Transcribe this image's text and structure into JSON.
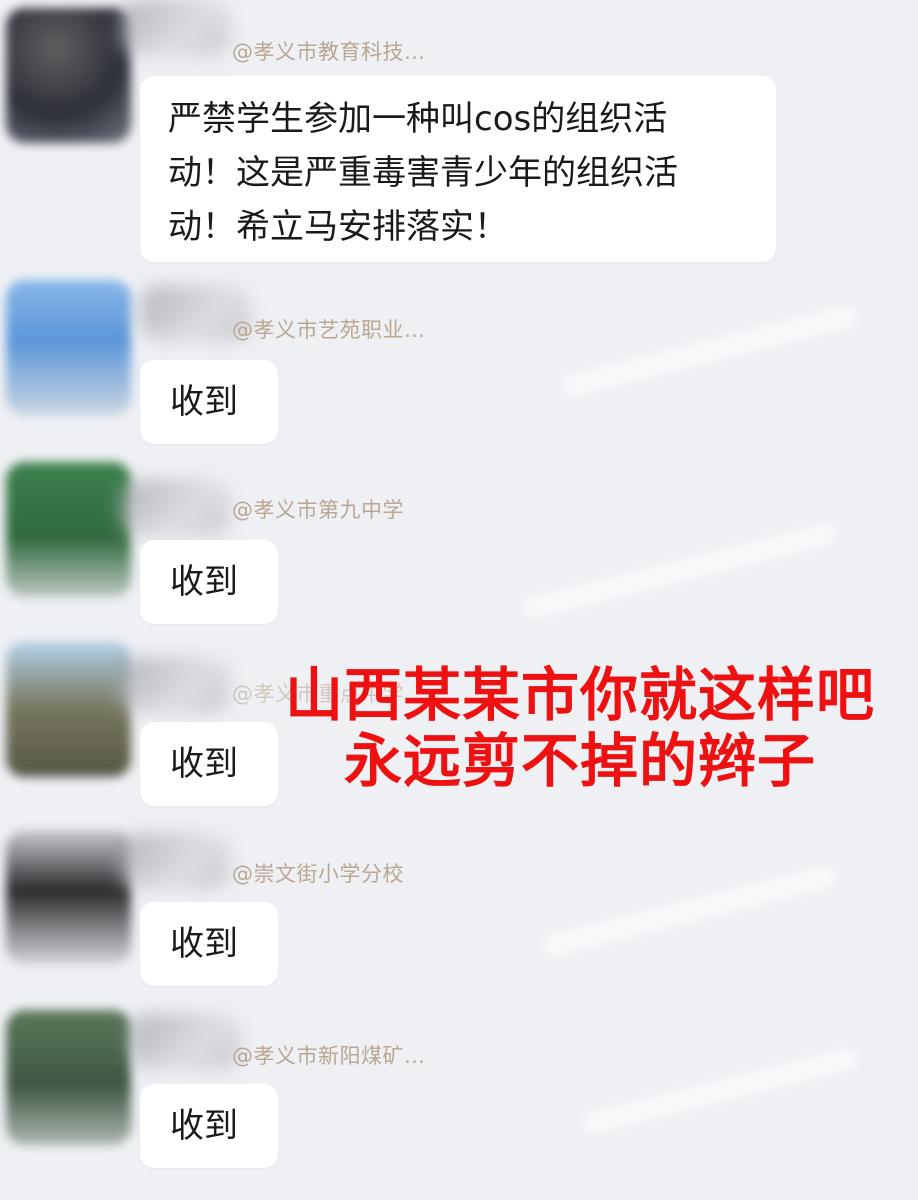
{
  "messages": [
    {
      "sender": "@孝义市教育科技…",
      "text_lines": [
        "严禁学生参加一种叫cos的组织活",
        "动！这是严重毒害青少年的组织活",
        "动！希立马安排落实！"
      ]
    },
    {
      "sender": "@孝义市艺苑职业…",
      "text": "收到"
    },
    {
      "sender": "@孝义市第九中学",
      "text": "收到"
    },
    {
      "sender": "@孝义市重点中学",
      "text": "收到"
    },
    {
      "sender": "@崇文街小学分校",
      "text": "收到"
    },
    {
      "sender": "@孝义市新阳煤矿…",
      "text": "收到"
    }
  ],
  "overlay": {
    "line1": "山西某某市你就这样吧",
    "line2": "永远剪不掉的辫子",
    "color": "#ee1111"
  }
}
